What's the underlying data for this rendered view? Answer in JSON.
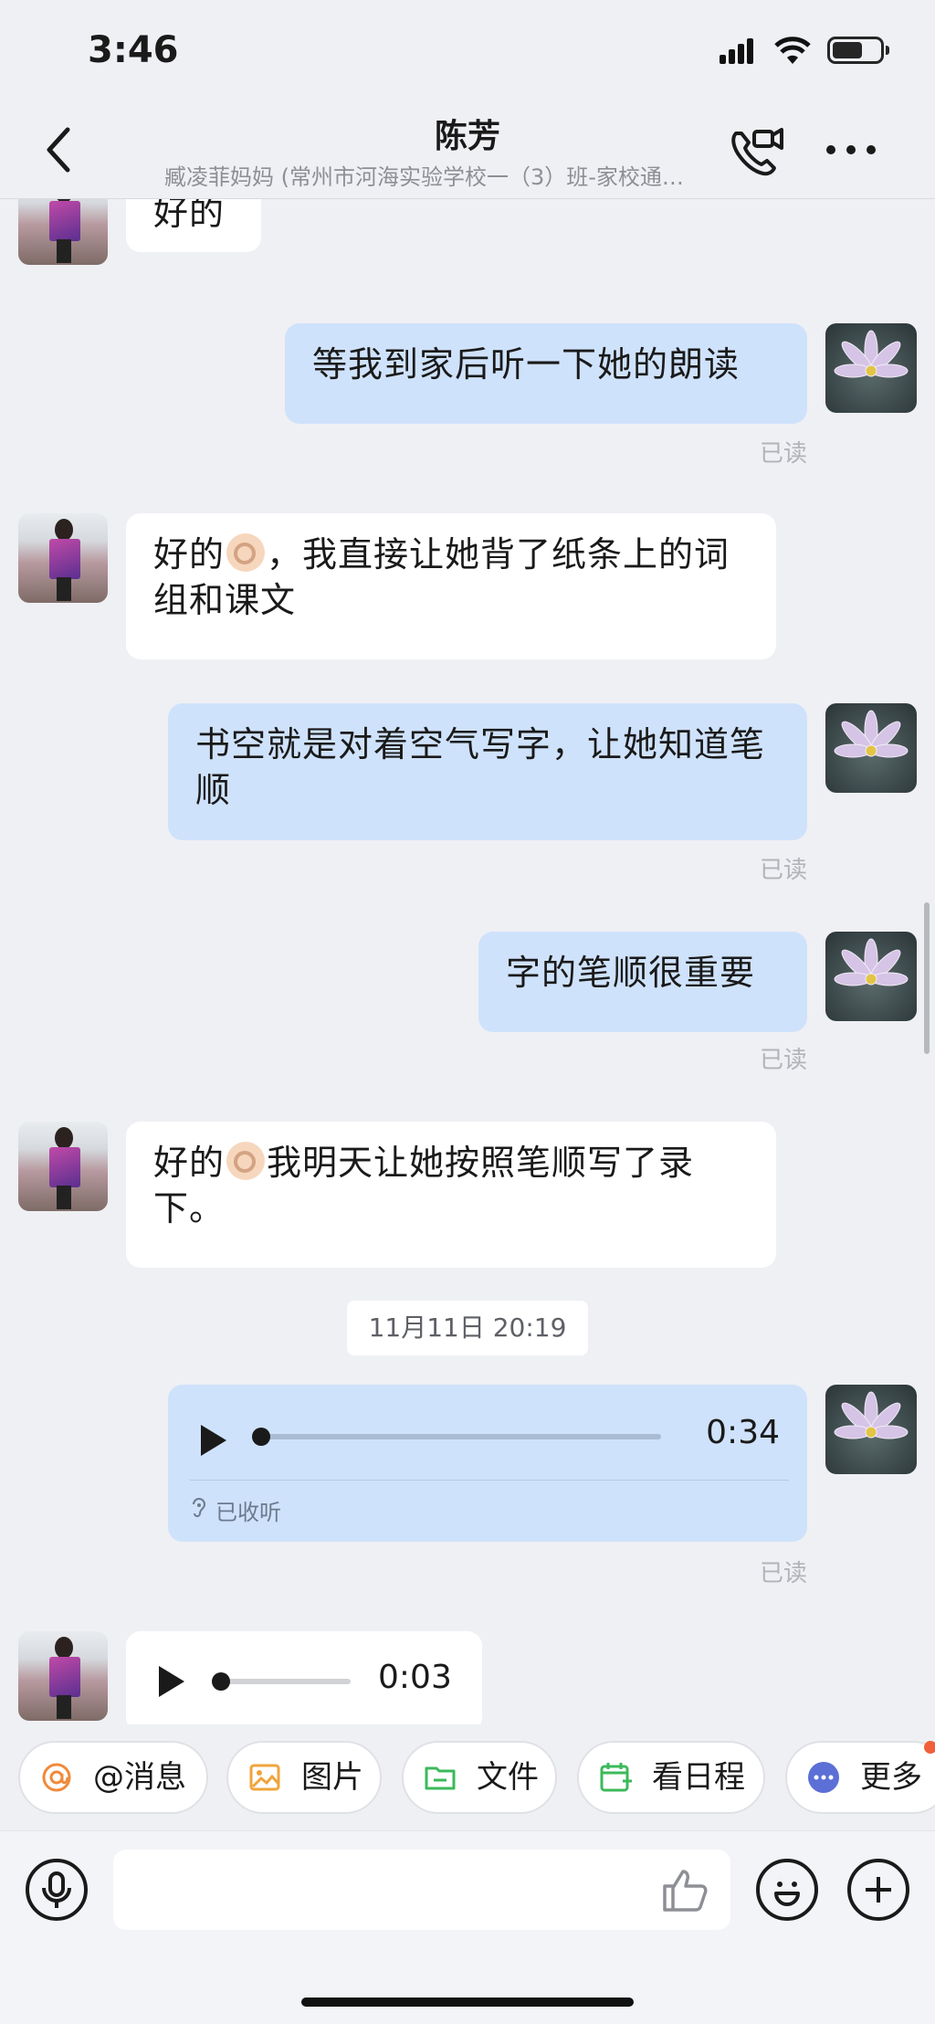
{
  "status_bar": {
    "time": "3:46"
  },
  "header": {
    "title": "陈芳",
    "subtitle": "臧凌菲妈妈 (常州市河海实验学校一（3）班-家校通…"
  },
  "messages": [
    {
      "side": "in",
      "text": "好的"
    },
    {
      "side": "out",
      "text": "等我到家后听一下她的朗读",
      "status": "已读"
    },
    {
      "side": "in",
      "text_before": "好的",
      "emoji": "ok-hand",
      "text_after": "，我直接让她背了纸条上的词组和课文"
    },
    {
      "side": "out",
      "text": "书空就是对着空气写字，让她知道笔顺",
      "status": "已读"
    },
    {
      "side": "out",
      "text": "字的笔顺很重要",
      "status": "已读"
    },
    {
      "side": "in",
      "text_before": "好的",
      "emoji": "ok-hand",
      "text_after": "我明天让她按照笔顺写了录下。"
    }
  ],
  "timestamp": "11月11日 20:19",
  "voice_out": {
    "duration": "0:34",
    "listened_label": "已收听",
    "status": "已读",
    "progress": 0
  },
  "voice_in": {
    "duration": "0:03",
    "progress": 0
  },
  "quick_actions": [
    {
      "label": "@消息",
      "icon": "at-icon",
      "color": "#f08a3c"
    },
    {
      "label": "图片",
      "icon": "image-icon",
      "color": "#f0a43c"
    },
    {
      "label": "文件",
      "icon": "folder-icon",
      "color": "#3cb95a"
    },
    {
      "label": "看日程",
      "icon": "calendar-icon",
      "color": "#3cb95a"
    },
    {
      "label": "更多",
      "icon": "more-dots-icon",
      "color": "#5b6fd6"
    }
  ],
  "colors": {
    "outgoing_bubble": "#cfe2fb",
    "incoming_bubble": "#ffffff",
    "background": "#eff0f4",
    "badge": "#f0603a"
  }
}
